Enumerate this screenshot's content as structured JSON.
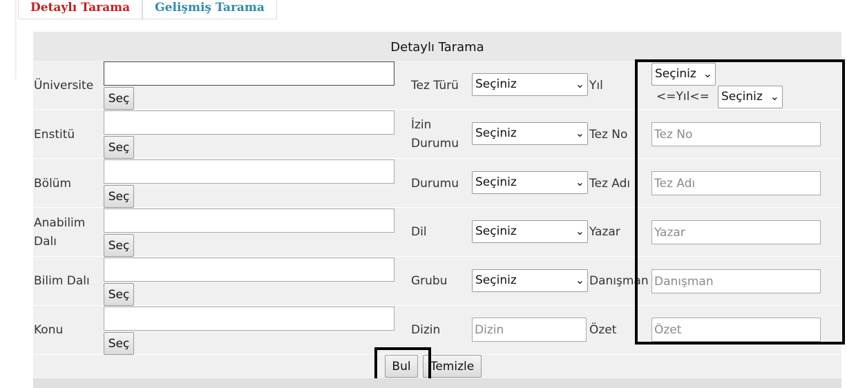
{
  "tabs": [
    {
      "label": "Detaylı Tarama",
      "active": true
    },
    {
      "label": "Gelişmiş Tarama",
      "active": false
    }
  ],
  "panel": {
    "title": "Detaylı Tarama"
  },
  "left_fields": [
    {
      "label": "Üniversite",
      "value": "",
      "button": "Seç"
    },
    {
      "label": "Enstitü",
      "value": "",
      "button": "Seç"
    },
    {
      "label": "Bölüm",
      "value": "",
      "button": "Seç"
    },
    {
      "label": "Anabilim Dalı",
      "value": "",
      "button": "Seç"
    },
    {
      "label": "Bilim Dalı",
      "value": "",
      "button": "Seç"
    },
    {
      "label": "Konu",
      "value": "",
      "button": "Seç"
    }
  ],
  "middle_fields": [
    {
      "label": "Tez Türü",
      "selected": "Seçiniz"
    },
    {
      "label": "İzin Durumu",
      "selected": "Seçiniz"
    },
    {
      "label": "Durumu",
      "selected": "Seçiniz"
    },
    {
      "label": "Dil",
      "selected": "Seçiniz"
    },
    {
      "label": "Grubu",
      "selected": "Seçiniz"
    },
    {
      "label": "Dizin",
      "placeholder": "Dizin"
    }
  ],
  "right_fields": {
    "year": {
      "label": "Yıl",
      "from_selected": "Seçiniz",
      "range_text": "<=Yıl<=",
      "to_selected": "Seçiniz"
    },
    "tez_no": {
      "label": "Tez No",
      "placeholder": "Tez No"
    },
    "tez_adi": {
      "label": "Tez Adı",
      "placeholder": "Tez Adı"
    },
    "yazar": {
      "label": "Yazar",
      "placeholder": "Yazar"
    },
    "danisman": {
      "label": "Danışman",
      "placeholder": "Danışman"
    },
    "ozet": {
      "label": "Özet",
      "placeholder": "Özet"
    }
  },
  "actions": {
    "search_label": "Bul",
    "clear_label": "Temizle"
  },
  "icons": {
    "select_arrow": "chevron-down-icon"
  }
}
